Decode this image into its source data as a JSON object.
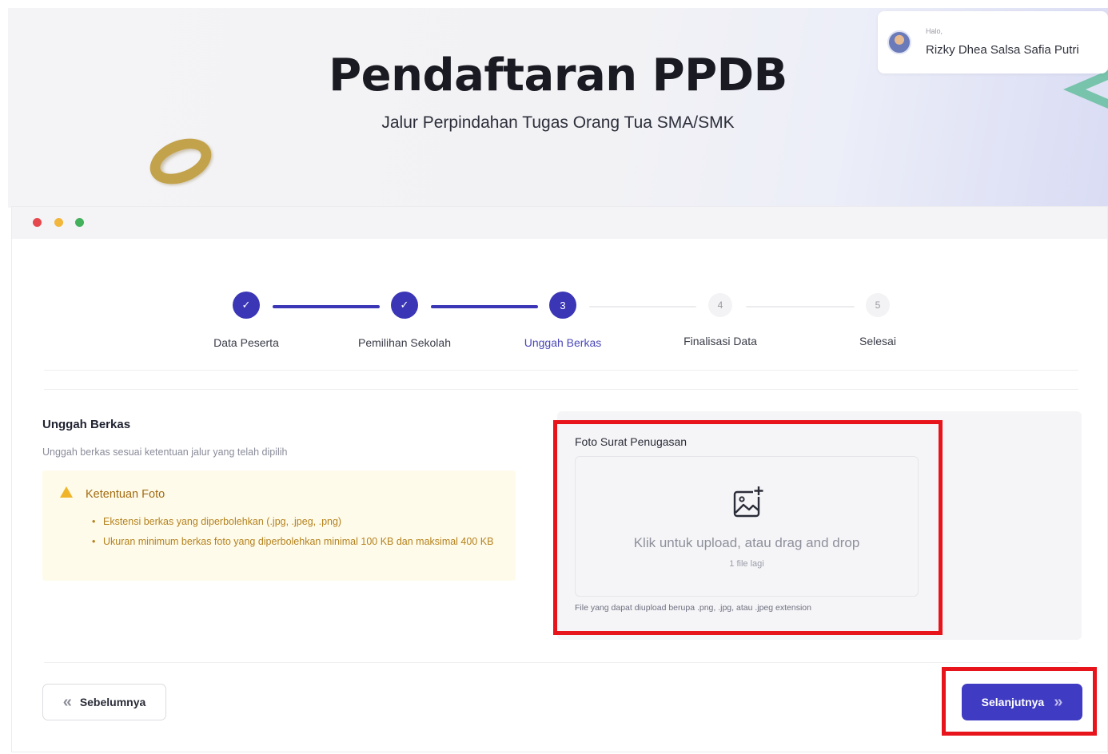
{
  "header": {
    "title": "Pendaftaran PPDB",
    "subtitle": "Jalur Perpindahan Tugas Orang Tua SMA/SMK"
  },
  "user": {
    "greeting": "Halo,",
    "name": "Rizky Dhea Salsa Safia Putri"
  },
  "stepper": {
    "steps": [
      {
        "label": "Data Peserta",
        "marker": "✓",
        "state": "done"
      },
      {
        "label": "Pemilihan Sekolah",
        "marker": "✓",
        "state": "done"
      },
      {
        "label": "Unggah Berkas",
        "marker": "3",
        "state": "active"
      },
      {
        "label": "Finalisasi Data",
        "marker": "4",
        "state": "pending"
      },
      {
        "label": "Selesai",
        "marker": "5",
        "state": "pending"
      }
    ]
  },
  "section": {
    "title": "Unggah Berkas",
    "description": "Unggah berkas sesuai ketentuan jalur yang telah dipilih"
  },
  "notice": {
    "title": "Ketentuan Foto",
    "items": [
      "Ekstensi berkas yang diperbolehkan (.jpg, .jpeg, .png)",
      "Ukuran minimum berkas foto yang diperbolehkan minimal 100 KB dan maksimal 400 KB"
    ]
  },
  "upload": {
    "label": "Foto Surat Penugasan",
    "prompt": "Klik untuk upload, atau drag and drop",
    "count": "1 file lagi",
    "help": "File yang dapat diupload berupa .png, .jpg, atau .jpeg extension"
  },
  "nav": {
    "prev_label": "Sebelumnya",
    "next_label": "Selanjutnya"
  },
  "colors": {
    "primary": "#3f3bc2",
    "highlight": "#e8141b",
    "notice_bg": "#fffbea",
    "notice_text": "#a26b10"
  }
}
